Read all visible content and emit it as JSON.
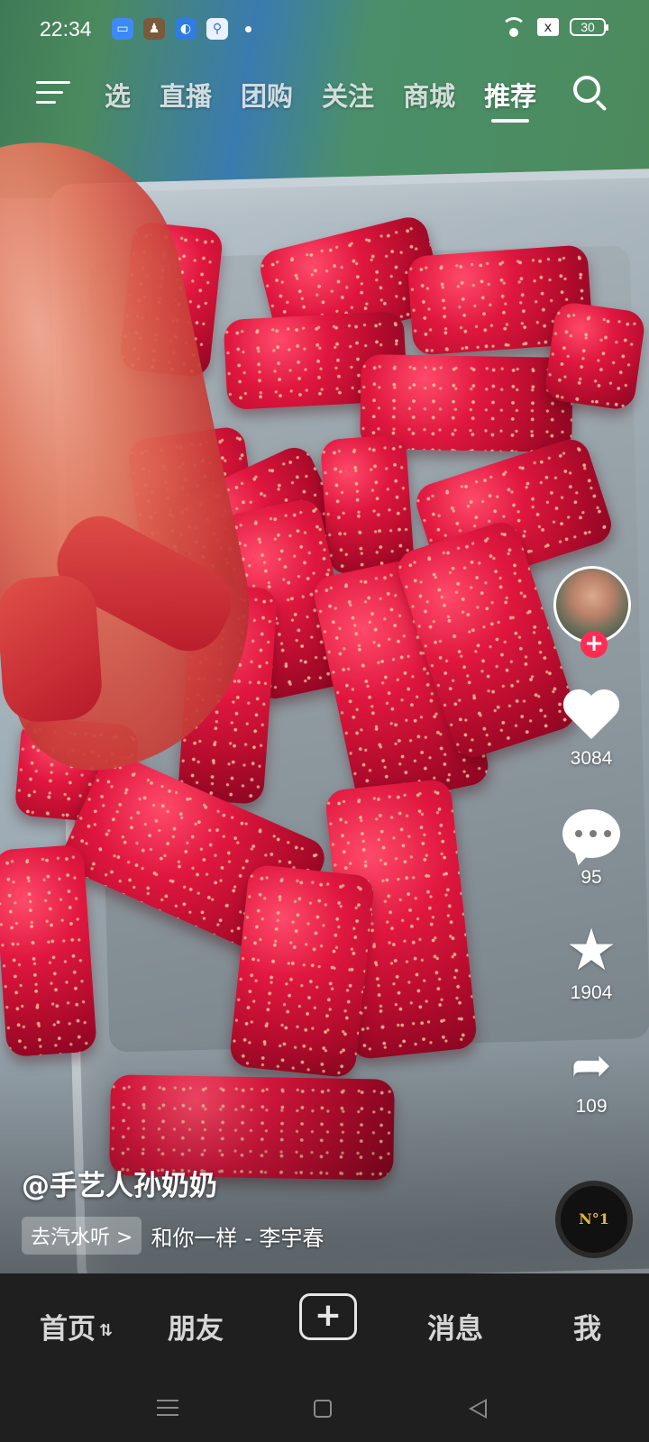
{
  "status_bar": {
    "time": "22:34",
    "battery": "30",
    "app_icons": [
      "message-app-icon",
      "game-app-icon",
      "browser-app-icon",
      "search-app-icon"
    ],
    "sim_indicator": "x"
  },
  "top_nav": {
    "tabs": [
      "选",
      "直播",
      "团购",
      "关注",
      "商城",
      "推荐"
    ],
    "active_tab": "推荐"
  },
  "video": {
    "author": "@手艺人孙奶奶",
    "music_chip": "去汽水听 >",
    "music_title": "和你一样 - 李宇春",
    "disc_label": "N°1"
  },
  "actions": {
    "likes": "3084",
    "comments": "95",
    "favorites": "1904",
    "shares": "109",
    "follow_symbol": "+"
  },
  "bottom_nav": {
    "home": "首页",
    "friends": "朋友",
    "add": "+",
    "messages": "消息",
    "me": "我"
  },
  "colors": {
    "accent": "#fe2c55",
    "nav_bg": "#1f1f1f"
  }
}
